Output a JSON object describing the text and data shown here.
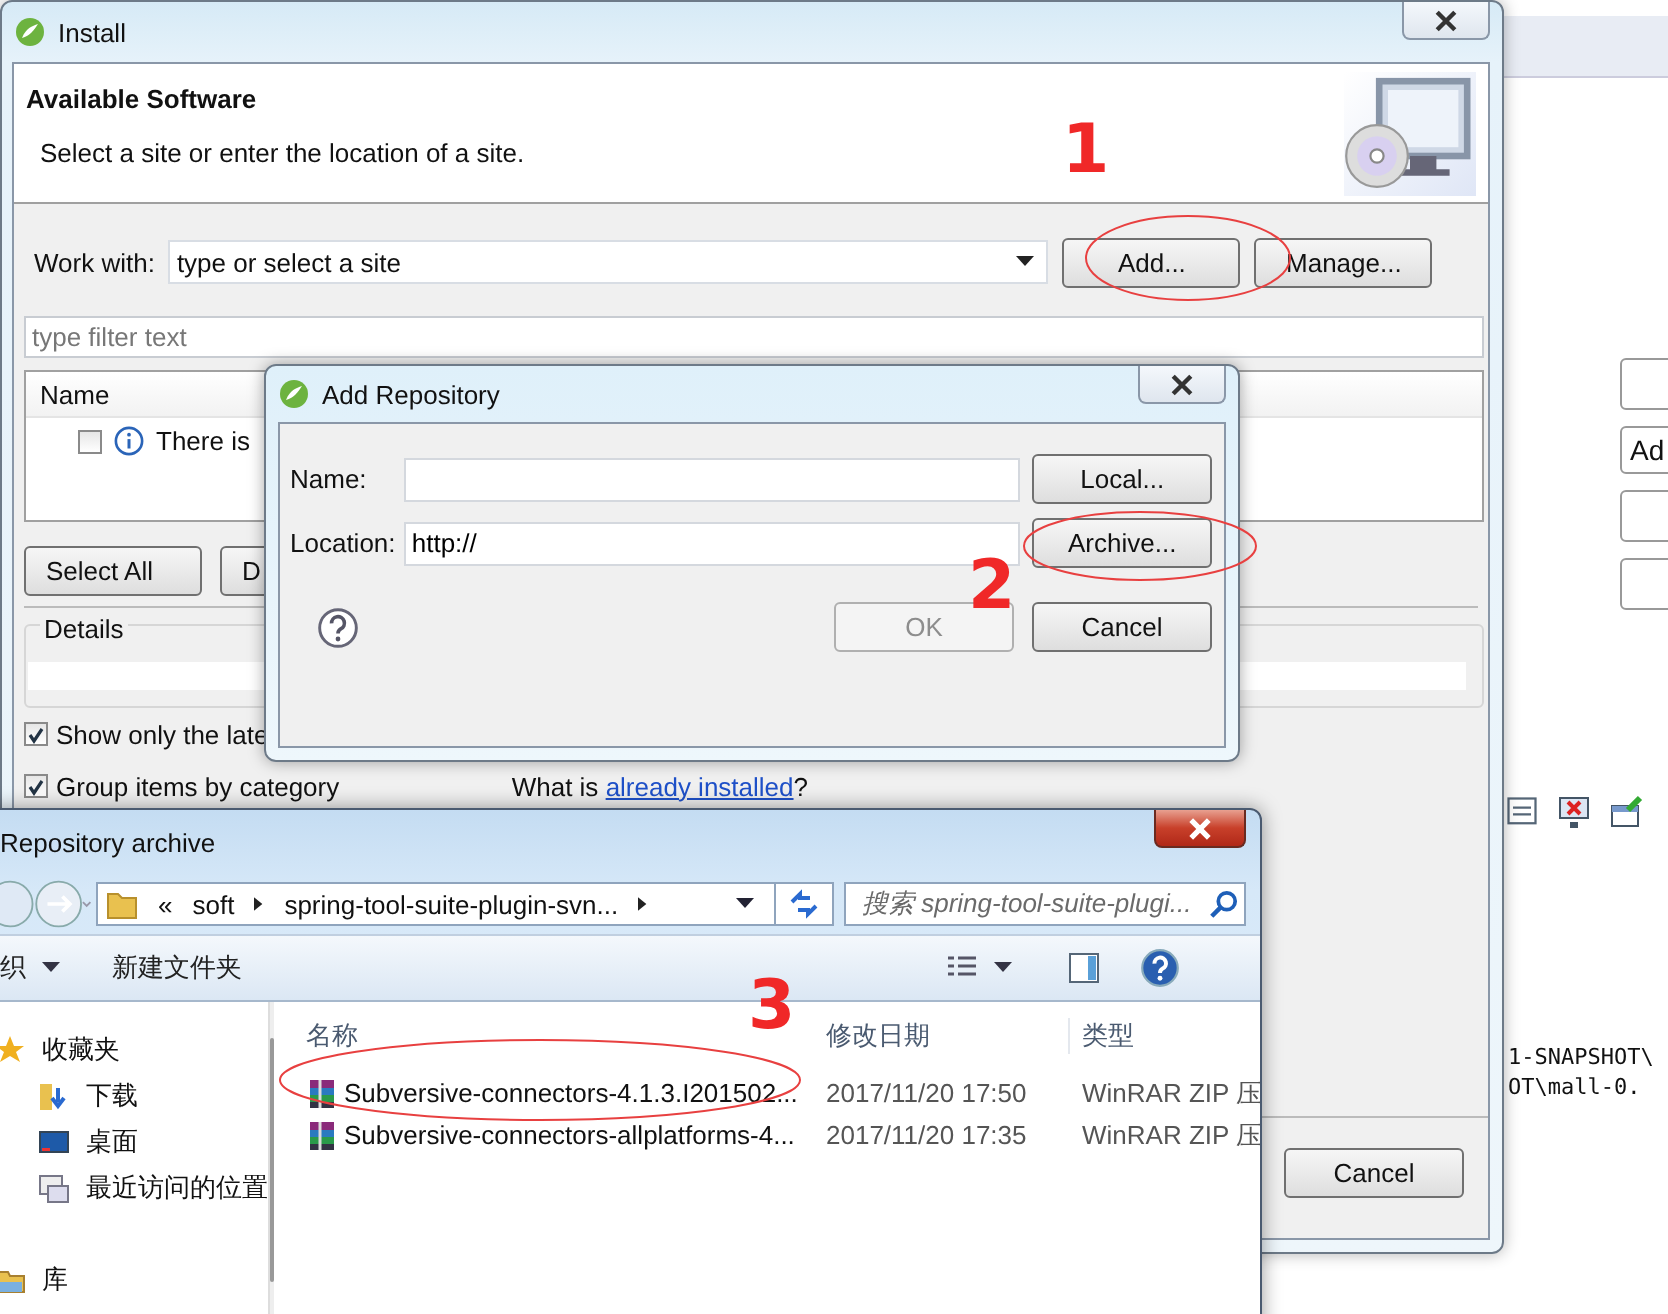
{
  "install": {
    "title": "Install",
    "heading": "Available Software",
    "description": "Select a site or enter the location of a site.",
    "work_with": {
      "label": "Work with:",
      "value": "type or select a site"
    },
    "site_buttons": [
      "Add...",
      "Manage..."
    ],
    "filter": {
      "placeholder": "type filter text"
    },
    "table": {
      "columns": [
        "Name"
      ],
      "rows": [
        {
          "text": "There is",
          "checked": false
        }
      ]
    },
    "selection_buttons": [
      "Select All",
      "D"
    ],
    "details": {
      "label": "Details"
    },
    "options": [
      {
        "label": "Show only the late",
        "checked": true
      },
      {
        "label": "Group items by category",
        "checked": true
      }
    ],
    "installed_note": {
      "before": "What is",
      "link": "already installed",
      "after": "?"
    },
    "footer_buttons": [
      "Cancel"
    ]
  },
  "add_repository": {
    "title": "Add Repository",
    "fields": [
      {
        "label": "Name:",
        "button": "Local..."
      },
      {
        "label": "Location:",
        "value": "http://",
        "button": "Archive..."
      }
    ],
    "actions": [
      {
        "label": "OK",
        "disabled": true
      },
      {
        "label": "Cancel",
        "disabled": false
      }
    ]
  },
  "archive_dialog": {
    "title": "Repository archive",
    "breadcrumb": [
      "«",
      "soft",
      "spring-tool-suite-plugin-svn..."
    ],
    "search": {
      "placeholder": "搜索 spring-tool-suite-plugi..."
    },
    "toolbar": [
      {
        "label": "织",
        "dropdown": true
      },
      {
        "label": "新建文件夹",
        "dropdown": false
      }
    ],
    "sidebar": [
      {
        "label": "收藏夹",
        "kind": "favorites"
      },
      {
        "label": "下载",
        "kind": "downloads"
      },
      {
        "label": "桌面",
        "kind": "desktop"
      },
      {
        "label": "最近访问的位置",
        "kind": "recent"
      },
      {
        "label": "库",
        "kind": "library"
      }
    ],
    "columns": [
      "名称",
      "修改日期",
      "类型"
    ],
    "rows": [
      {
        "name": "Subversive-connectors-4.1.3.I201502...",
        "modified": "2017/11/20 17:50",
        "type": "WinRAR ZIP 压"
      },
      {
        "name": "Subversive-connectors-allplatforms-4...",
        "modified": "2017/11/20 17:35",
        "type": "WinRAR ZIP 压"
      }
    ]
  },
  "background_ide": {
    "button": "Ad",
    "console_lines": [
      "1-SNAPSHOT\\",
      "OT\\mall-0."
    ]
  },
  "annotations": [
    {
      "label": "1"
    },
    {
      "label": "2"
    },
    {
      "label": "3"
    }
  ]
}
